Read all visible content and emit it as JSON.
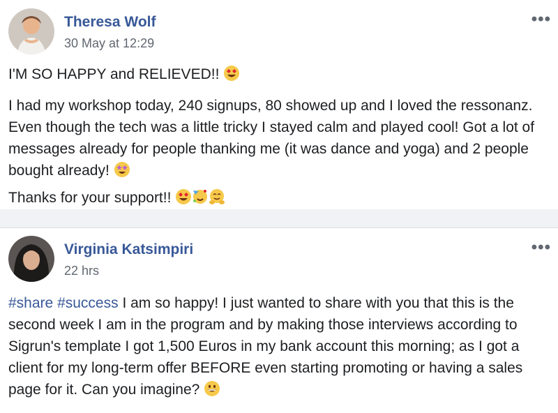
{
  "posts": [
    {
      "author": "Theresa Wolf",
      "time": "30 May at 12:29",
      "paragraphs": [
        "I'M SO HAPPY and RELIEVED!!",
        "I had my workshop today, 240 signups, 80 showed up and I loved the ressonanz. Even though the tech was a little tricky I stayed calm and played cool! Got a lot of messages already for people thanking me (it was dance and yoga) and 2 people bought already!",
        "Thanks for your support!!"
      ],
      "emojis": {
        "p1": [
          "heart-eyes-emoji"
        ],
        "p2": [
          "star-struck-emoji"
        ],
        "p3": [
          "heart-eyes-emoji",
          "partying-face-emoji",
          "hugging-face-emoji"
        ]
      }
    },
    {
      "author": "Virginia Katsimpiri",
      "time": "22 hrs",
      "hashtags": [
        "#share",
        "#success"
      ],
      "text_after_hashtags": " I am so happy! I just wanted to share with you that this is the second week I am in the program and by making those interviews according to Sigrun's template I got 1,500 Euros in my bank account this morning; as I got a client for my long-term offer BEFORE even starting promoting or having a sales page for it. Can you imagine?",
      "emoji": "grinning-face-emoji"
    }
  ],
  "colors": {
    "link": "#385898",
    "meta": "#606770",
    "text": "#1c1e21",
    "background": "#f0f2f5",
    "card": "#ffffff"
  },
  "more_glyph": "•••"
}
